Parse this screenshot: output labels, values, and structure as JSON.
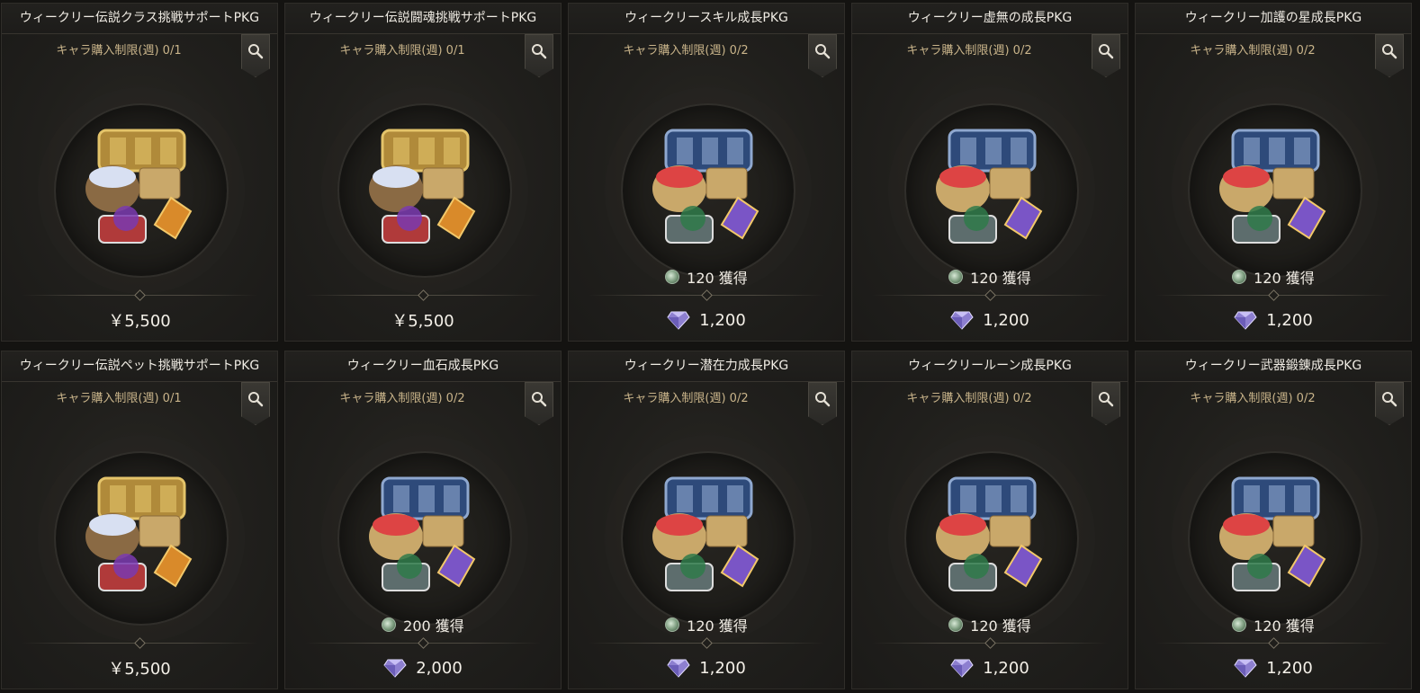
{
  "cards": [
    {
      "title": "ウィークリー伝説クラス挑戦サポートPKG",
      "limit": "キャラ購入制限(週) 0/1",
      "earn": "",
      "price": "￥5,500",
      "currency": "yen",
      "art": "gold"
    },
    {
      "title": "ウィークリー伝説闘魂挑戦サポートPKG",
      "limit": "キャラ購入制限(週) 0/1",
      "earn": "",
      "price": "￥5,500",
      "currency": "yen",
      "art": "gold"
    },
    {
      "title": "ウィークリースキル成長PKG",
      "limit": "キャラ購入制限(週) 0/2",
      "earn": "120 獲得",
      "price": "1,200",
      "currency": "gem",
      "art": "blue"
    },
    {
      "title": "ウィークリー虚無の成長PKG",
      "limit": "キャラ購入制限(週) 0/2",
      "earn": "120 獲得",
      "price": "1,200",
      "currency": "gem",
      "art": "blue"
    },
    {
      "title": "ウィークリー加護の星成長PKG",
      "limit": "キャラ購入制限(週) 0/2",
      "earn": "120 獲得",
      "price": "1,200",
      "currency": "gem",
      "art": "blue"
    },
    {
      "title": "ウィークリー伝説ペット挑戦サポートPKG",
      "limit": "キャラ購入制限(週) 0/1",
      "earn": "",
      "price": "￥5,500",
      "currency": "yen",
      "art": "gold"
    },
    {
      "title": "ウィークリー血石成長PKG",
      "limit": "キャラ購入制限(週) 0/2",
      "earn": "200 獲得",
      "price": "2,000",
      "currency": "gem",
      "art": "blue"
    },
    {
      "title": "ウィークリー潜在力成長PKG",
      "limit": "キャラ購入制限(週) 0/2",
      "earn": "120 獲得",
      "price": "1,200",
      "currency": "gem",
      "art": "blue"
    },
    {
      "title": "ウィークリールーン成長PKG",
      "limit": "キャラ購入制限(週) 0/2",
      "earn": "120 獲得",
      "price": "1,200",
      "currency": "gem",
      "art": "blue"
    },
    {
      "title": "ウィークリー武器鍛錬成長PKG",
      "limit": "キャラ購入制限(週) 0/2",
      "earn": "120 獲得",
      "price": "1,200",
      "currency": "gem",
      "art": "blue"
    }
  ],
  "icons": {
    "zoom": "magnifier-icon",
    "earn": "mileage-coin-icon",
    "gem": "diamond-gem-icon"
  },
  "colors": {
    "background": "#141311",
    "limit_text": "#c9b48a",
    "title_text": "#f0ece4"
  }
}
